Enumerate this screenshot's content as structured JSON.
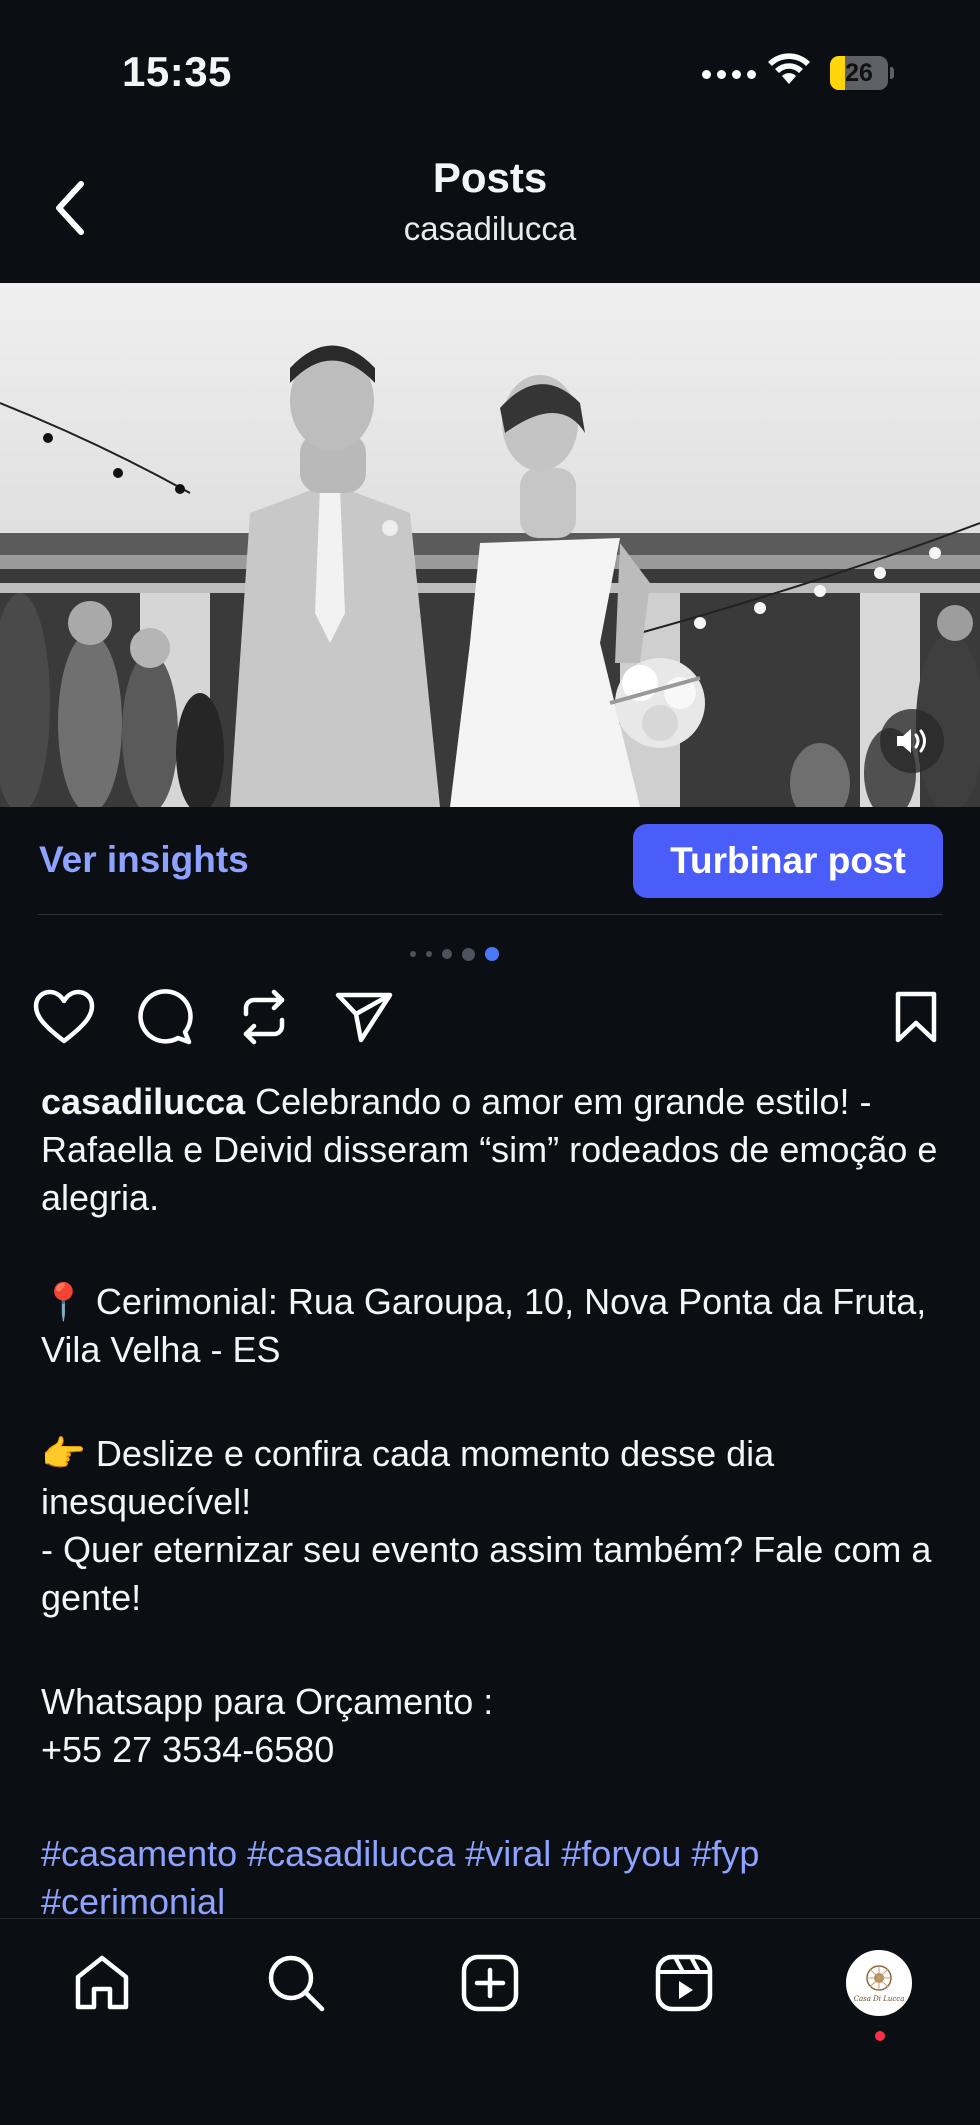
{
  "status_bar": {
    "time": "15:35",
    "battery_level": "26",
    "battery_fraction": 0.26,
    "signal_icon": "signal-dots-icon",
    "wifi_icon": "wifi-icon"
  },
  "header": {
    "title": "Posts",
    "subtitle": "casadilucca",
    "back_icon": "chevron-left-icon"
  },
  "media": {
    "carousel_total": 5,
    "carousel_active_index": 4,
    "sound_icon": "speaker-icon"
  },
  "insights": {
    "link_label": "Ver insights",
    "boost_label": "Turbinar post"
  },
  "actions": {
    "like_icon": "heart-icon",
    "comment_icon": "comment-icon",
    "repost_icon": "repost-icon",
    "share_icon": "send-icon",
    "save_icon": "bookmark-icon"
  },
  "caption": {
    "username": "casadilucca",
    "line1": " Celebrando o amor em grande estilo! - Rafaella e Deivid disseram “sim” rodeados de emoção e alegria.",
    "location_emoji": "📍",
    "location": " Cerimonial: Rua Garoupa, 10, Nova Ponta da Fruta, Vila Velha - ES",
    "pointer_emoji": "👉",
    "swipe": " Deslize e confira cada momento desse dia inesquecível!",
    "cta": "- Quer eternizar seu evento assim também? Fale com a gente!",
    "whatsapp_label": "Whatsapp para Orçamento :",
    "phone": "+55 27 3534-6580",
    "hashtags": "#casamento #casadilucca #viral #foryou #fyp #cerimonial"
  },
  "bottom_nav": {
    "home_icon": "home-icon",
    "search_icon": "search-icon",
    "create_icon": "plus-square-icon",
    "reels_icon": "reels-icon",
    "profile_logo_text": "Casa Di Lucca"
  },
  "colors": {
    "background": "#0b0f14",
    "accent": "#4a5df9",
    "link": "#8ea2ff",
    "notification": "#ff2d48"
  }
}
